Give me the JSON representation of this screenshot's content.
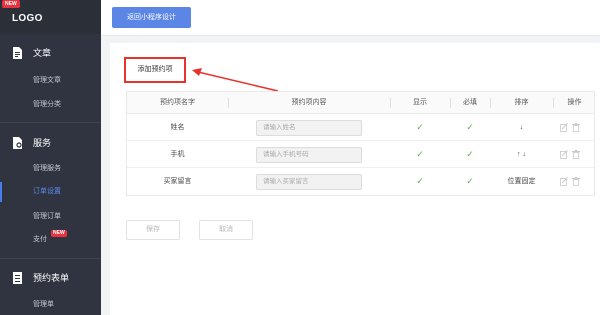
{
  "sidebar": {
    "logo": "LOGO",
    "logo_badge": "NEW",
    "sections": [
      {
        "title": "文章",
        "icon": "document-icon",
        "items": [
          "管理文章",
          "管理分类"
        ]
      },
      {
        "title": "服务",
        "icon": "service-icon",
        "items": [
          "管理服务",
          "订单设置",
          "管理订单",
          "支付"
        ]
      },
      {
        "title": "预约表单",
        "icon": "form-icon",
        "items": [
          "管理单"
        ]
      }
    ],
    "active_item": "订单设置",
    "pay_badge": "NEW"
  },
  "topbar": {
    "back_label": "返回小程序设计"
  },
  "main": {
    "add_label": "添加预约项",
    "columns": [
      "预约项名字",
      "预约项内容",
      "显示",
      "必填",
      "排序",
      "操作"
    ],
    "rows": [
      {
        "name": "姓名",
        "placeholder": "请输入姓名",
        "show": "✓",
        "required": "✓",
        "sort": "↓"
      },
      {
        "name": "手机",
        "placeholder": "请输入手机号码",
        "show": "✓",
        "required": "✓",
        "sort": "↑ ↓"
      },
      {
        "name": "买家留言",
        "placeholder": "请输入买家留言",
        "show": "✓",
        "required": "✓",
        "sort": "位置固定"
      }
    ],
    "save_label": "保存",
    "cancel_label": "取消"
  },
  "colors": {
    "accent": "#5b86e5",
    "sidebar": "#2f3440",
    "highlight": "#e8332d",
    "check": "#5ab356"
  }
}
